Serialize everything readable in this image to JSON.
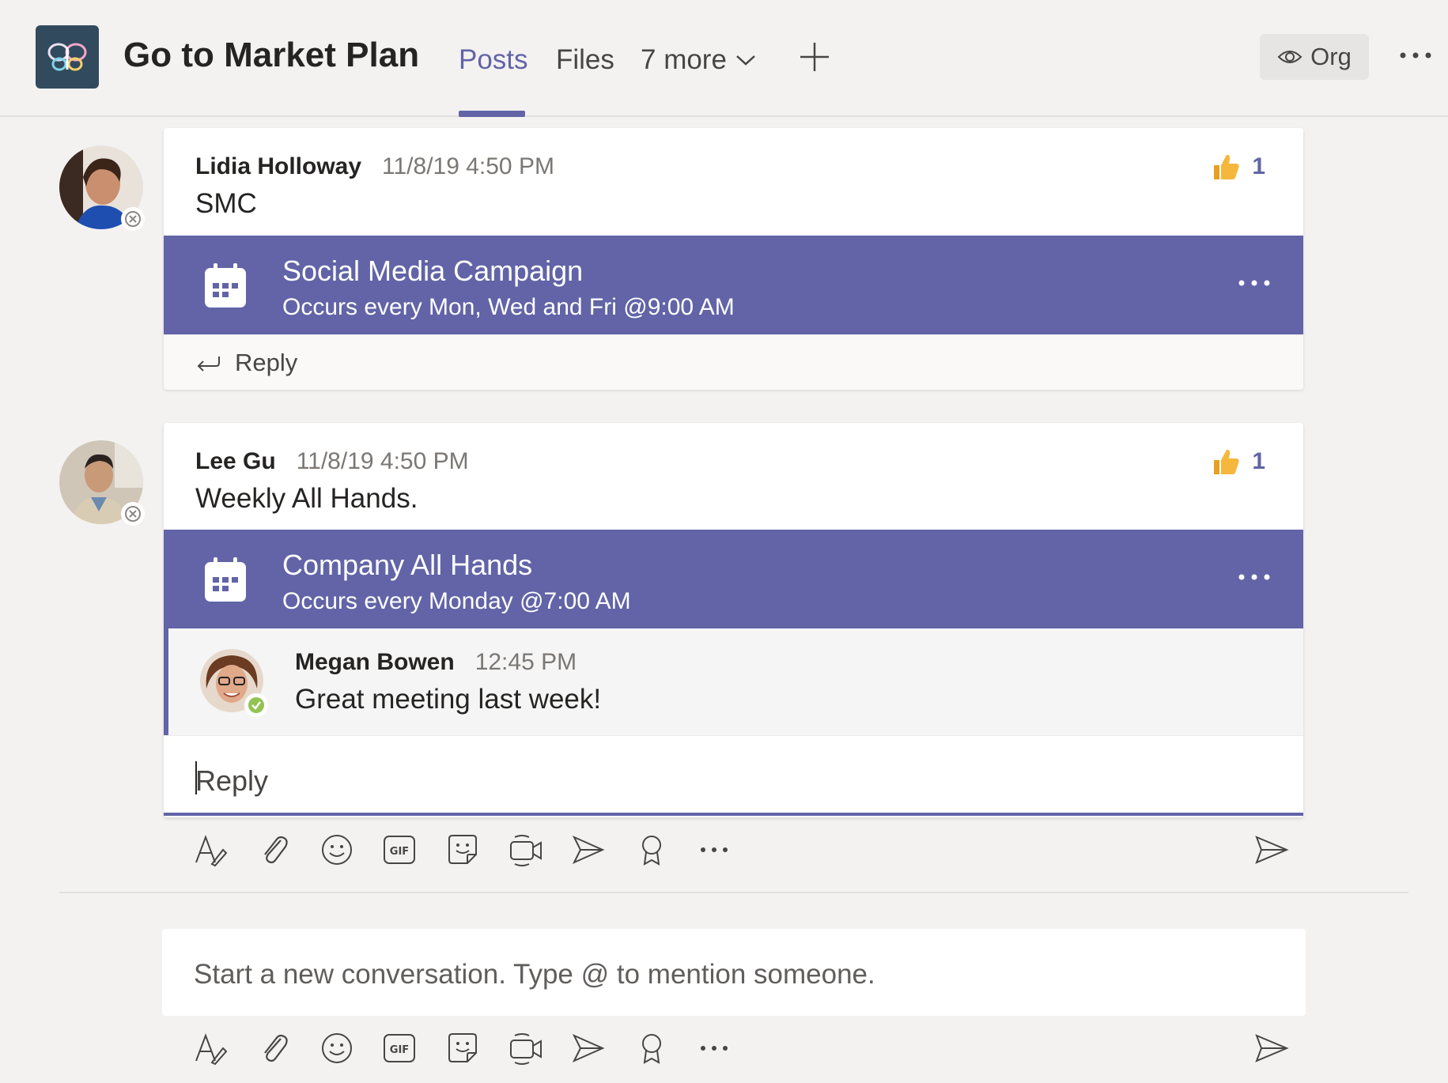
{
  "header": {
    "team_name": "Go to Market Plan",
    "tabs": [
      {
        "label": "Posts",
        "active": true
      },
      {
        "label": "Files",
        "active": false
      }
    ],
    "more_tabs_label": "7 more",
    "org_label": "Org"
  },
  "posts": [
    {
      "author": "Lidia Holloway",
      "timestamp": "11/8/19 4:50 PM",
      "body": "SMC",
      "reaction_count": "1",
      "meeting": {
        "title": "Social Media Campaign",
        "recurrence": "Occurs every Mon, Wed and Fri @9:00 AM"
      },
      "reply_label": "Reply"
    },
    {
      "author": "Lee Gu",
      "timestamp": "11/8/19 4:50 PM",
      "body": "Weekly All Hands.",
      "reaction_count": "1",
      "meeting": {
        "title": "Company All Hands",
        "recurrence": "Occurs every Monday @7:00 AM"
      },
      "replies": [
        {
          "author": "Megan Bowen",
          "timestamp": "12:45 PM",
          "body": "Great meeting last week!"
        }
      ],
      "reply_input_placeholder": "Reply"
    }
  ],
  "compose": {
    "placeholder": "Start a new conversation. Type @ to mention someone."
  },
  "colors": {
    "accent": "#6264a7",
    "background": "#f3f2f1",
    "reaction": "#f5b83d",
    "presence_available": "#92c353"
  },
  "toolbar_icons": [
    "format-icon",
    "attach-icon",
    "emoji-icon",
    "gif-icon",
    "sticker-icon",
    "meet-now-icon",
    "stream-icon",
    "praise-icon",
    "more-options-icon",
    "send-icon"
  ]
}
